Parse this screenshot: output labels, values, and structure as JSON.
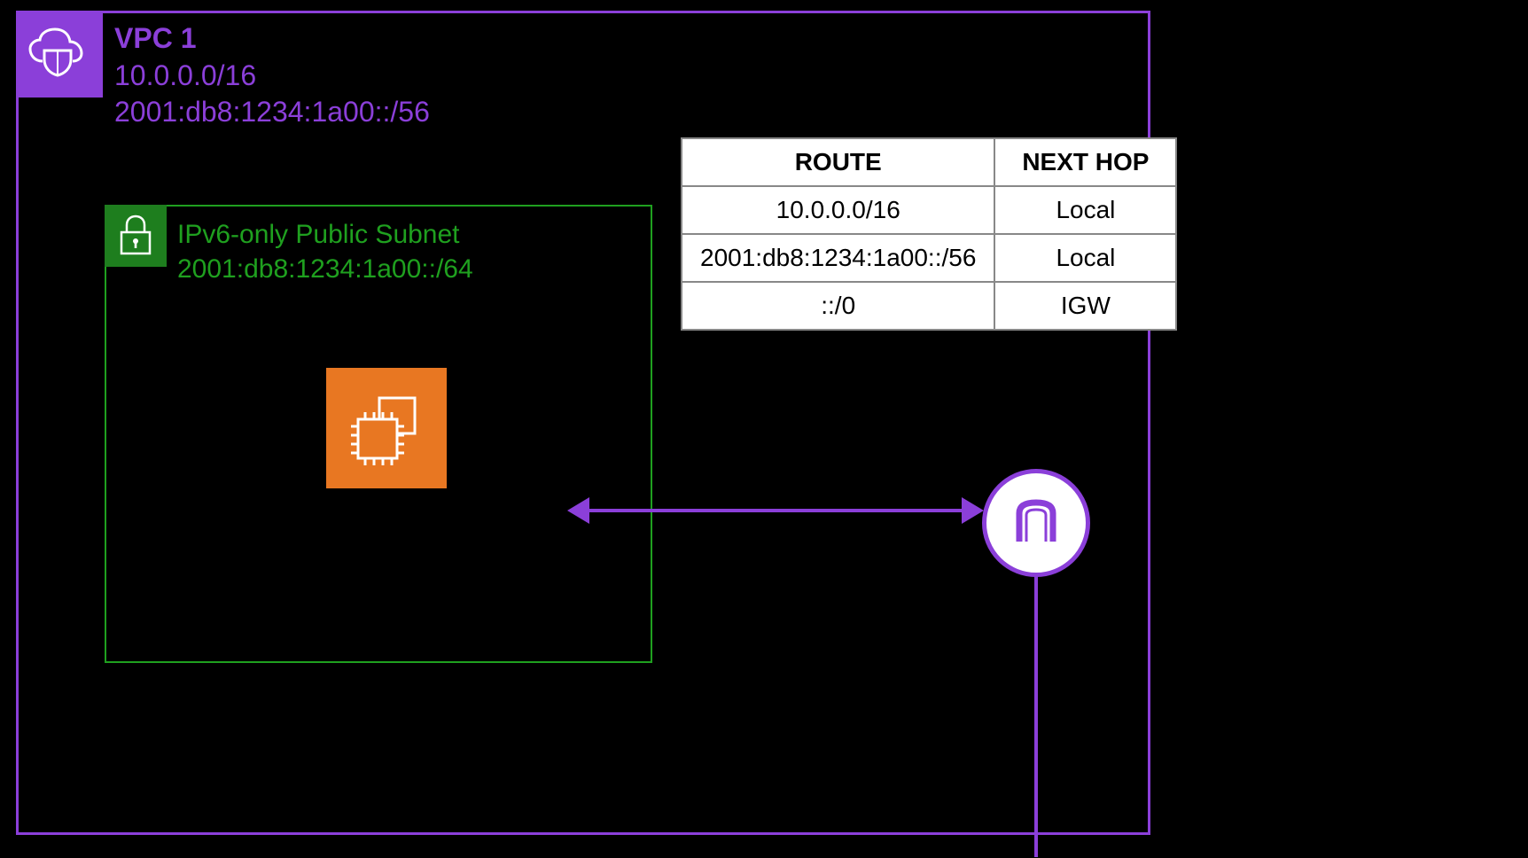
{
  "vpc": {
    "title": "VPC 1",
    "ipv4_cidr": "10.0.0.0/16",
    "ipv6_cidr": "2001:db8:1234:1a00::/56"
  },
  "subnet": {
    "title": "IPv6-only Public Subnet",
    "ipv6_cidr": "2001:db8:1234:1a00::/64"
  },
  "route_table": {
    "headers": {
      "route": "ROUTE",
      "next_hop": "NEXT HOP"
    },
    "rows": [
      {
        "route": "10.0.0.0/16",
        "next_hop": "Local"
      },
      {
        "route": "2001:db8:1234:1a00::/56",
        "next_hop": "Local"
      },
      {
        "route": "::/0",
        "next_hop": "IGW"
      }
    ]
  },
  "icons": {
    "vpc": "vpc-cloud-shield-icon",
    "subnet": "padlock-icon",
    "ec2": "ec2-instance-icon",
    "igw": "internet-gateway-icon"
  }
}
